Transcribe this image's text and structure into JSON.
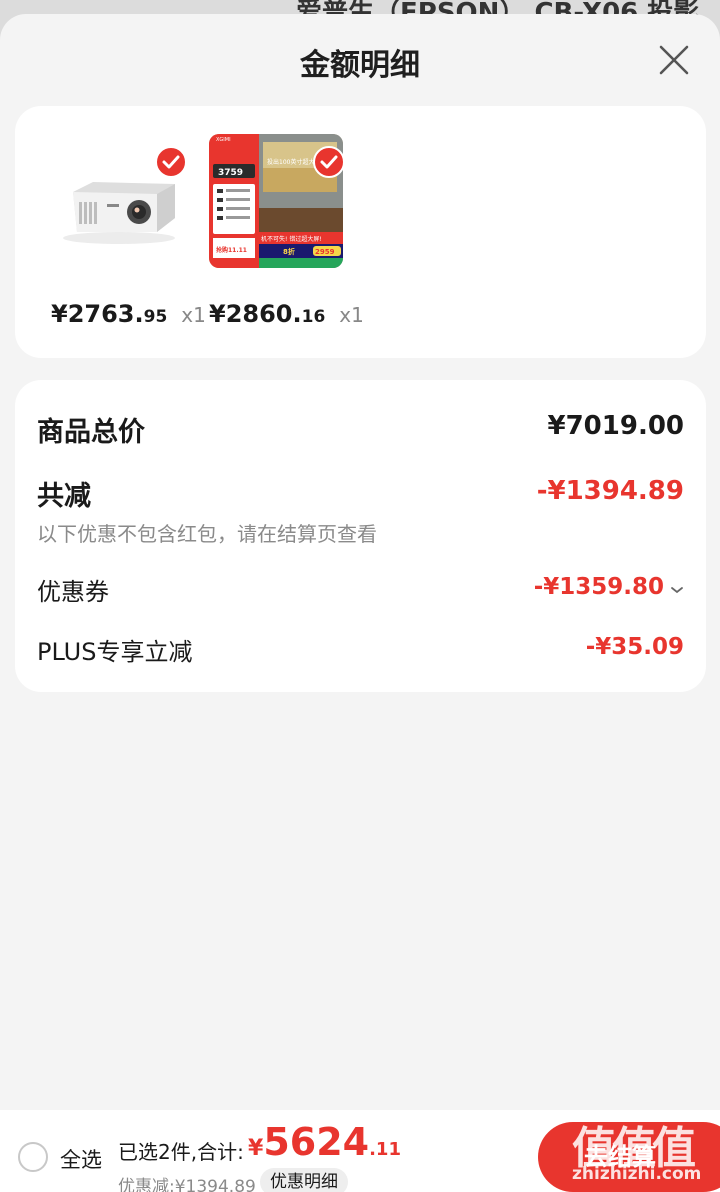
{
  "background": {
    "title_fragment": "爱普生（EPSON） CB-X06 投影"
  },
  "sheet": {
    "title": "金额明细",
    "close_icon": "close-icon"
  },
  "products": [
    {
      "price_int": "¥2763.",
      "price_dec": "95",
      "qty": "x1",
      "checked": true
    },
    {
      "price_int": "¥2860.",
      "price_dec": "16",
      "qty": "x1",
      "checked": true
    }
  ],
  "promo_image": {
    "brand": "XGIMI",
    "price": "3759",
    "headline": "投出100英寸超大画面",
    "banner": "机不可失! 错过超大屏!",
    "discount": "8折",
    "final_price": "2959",
    "event": "抢购11.11"
  },
  "summary": {
    "total_label": "商品总价",
    "total_value": "¥7019.00",
    "reduce_label": "共减",
    "reduce_value": "-¥1394.89",
    "note": "以下优惠不包含红包，请在结算页查看",
    "coupon_label": "优惠券",
    "coupon_value": "-¥1359.80",
    "plus_label": "PLUS专享立减",
    "plus_value": "-¥35.09"
  },
  "bottom": {
    "select_all": "全选",
    "selected": "已选2件,合计:",
    "total_currency": "¥",
    "total_int": "5624",
    "total_dec": ".11",
    "discount": "优惠减:¥1394.89",
    "detail_chip": "优惠明细",
    "checkout": "去结算"
  },
  "watermark": {
    "big": "值值值",
    "small": "zhizhizhi.com"
  },
  "colors": {
    "accent": "#e8352e",
    "sheet_bg": "#f4f4f4",
    "card_bg": "#ffffff"
  }
}
